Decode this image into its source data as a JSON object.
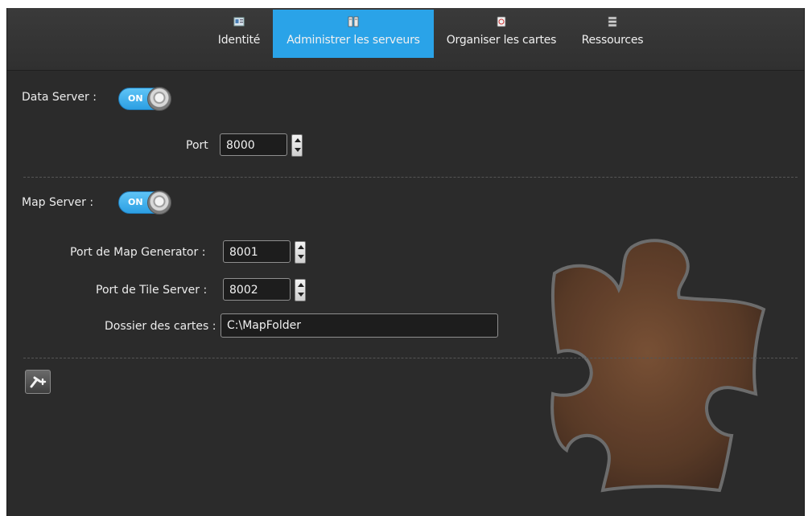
{
  "tabs": [
    {
      "label": "Identité",
      "icon": "id-card-icon",
      "active": false
    },
    {
      "label": "Administrer les serveurs",
      "icon": "servers-icon",
      "active": true
    },
    {
      "label": "Organiser les cartes",
      "icon": "map-document-icon",
      "active": false
    },
    {
      "label": "Ressources",
      "icon": "resources-stack-icon",
      "active": false
    }
  ],
  "data_server": {
    "label": "Data Server :",
    "toggle": "ON",
    "port_label": "Port",
    "port_value": "8000"
  },
  "map_server": {
    "label": "Map Server :",
    "toggle": "ON",
    "map_generator_label": "Port de Map Generator :",
    "map_generator_value": "8001",
    "tile_server_label": "Port de Tile Server :",
    "tile_server_value": "8002",
    "folder_label": "Dossier des cartes :",
    "folder_value": "C:\\MapFolder"
  },
  "actions": {
    "add_plugin_icon": "add-plugin-icon"
  },
  "decor": {
    "watermark_icon": "puzzle-piece-icon"
  },
  "colors": {
    "accent": "#2aa3e8",
    "background": "#2b2b2b",
    "puzzle": "#6b4530"
  }
}
